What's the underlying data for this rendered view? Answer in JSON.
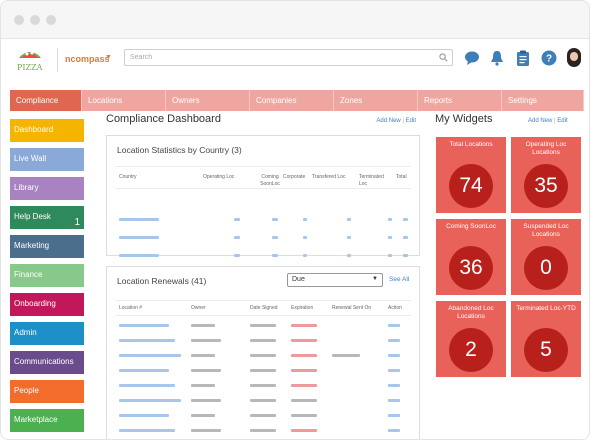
{
  "company": {
    "name": "ncompass",
    "logo_text": "PIZZA"
  },
  "search": {
    "placeholder": "Search"
  },
  "nav": [
    {
      "label": "Compliance",
      "active": true
    },
    {
      "label": "Locations",
      "active": false
    },
    {
      "label": "Owners",
      "active": false
    },
    {
      "label": "Companies",
      "active": false
    },
    {
      "label": "Zones",
      "active": false
    },
    {
      "label": "Reports",
      "active": false
    },
    {
      "label": "Settings",
      "active": false
    }
  ],
  "sidebar": [
    {
      "label": "Dashboard",
      "color": "#f4b400",
      "count": ""
    },
    {
      "label": "Live Wall",
      "color": "#8aa9d8",
      "count": ""
    },
    {
      "label": "Library",
      "color": "#a983c1",
      "count": ""
    },
    {
      "label": "Help Desk",
      "color": "#2e8a5a",
      "count": "1"
    },
    {
      "label": "Marketing",
      "color": "#4a6e8c",
      "count": ""
    },
    {
      "label": "Finance",
      "color": "#86c98a",
      "count": ""
    },
    {
      "label": "Onboarding",
      "color": "#c2185b",
      "count": ""
    },
    {
      "label": "Admin",
      "color": "#1e90c8",
      "count": ""
    },
    {
      "label": "Communications",
      "color": "#6a4c8c",
      "count": ""
    },
    {
      "label": "People",
      "color": "#f26c2b",
      "count": ""
    },
    {
      "label": "Marketplace",
      "color": "#4caf50",
      "count": ""
    }
  ],
  "main": {
    "title": "Compliance Dashboard",
    "add_new": "Add New",
    "edit": "Edit",
    "stats_panel": {
      "title": "Location Statistics by Country (3)",
      "headers": [
        "Country",
        "Operating Loc",
        "Coming SoonLoc",
        "Corporate",
        "Transfered Loc",
        "Terminated Loc",
        "Total"
      ]
    },
    "renewals_panel": {
      "title": "Location Renewals (41)",
      "select_value": "Due",
      "see_all": "See All",
      "headers": [
        "Location #",
        "Owner",
        "Date Signed",
        "Expiration",
        "Renewal Sent On",
        "Action"
      ]
    }
  },
  "widgets": {
    "title": "My Widgets",
    "add_new": "Add New",
    "edit": "Edit",
    "tiles": [
      {
        "label": "Total Locations",
        "value": "74"
      },
      {
        "label": "Operating Loc Locations",
        "value": "35"
      },
      {
        "label": "Coming SoonLoc",
        "value": "36"
      },
      {
        "label": "Suspended Loc Locations",
        "value": "0"
      },
      {
        "label": "Abandoned Loc Locations",
        "value": "2"
      },
      {
        "label": "Terminated Loc-YTD",
        "value": "5"
      }
    ]
  },
  "colors": {
    "accent": "#e0674f",
    "nav_inactive": "#f0a6a0",
    "tile": "#e8625a",
    "tile_circle": "#b8201c",
    "link": "#3b7fd1"
  }
}
